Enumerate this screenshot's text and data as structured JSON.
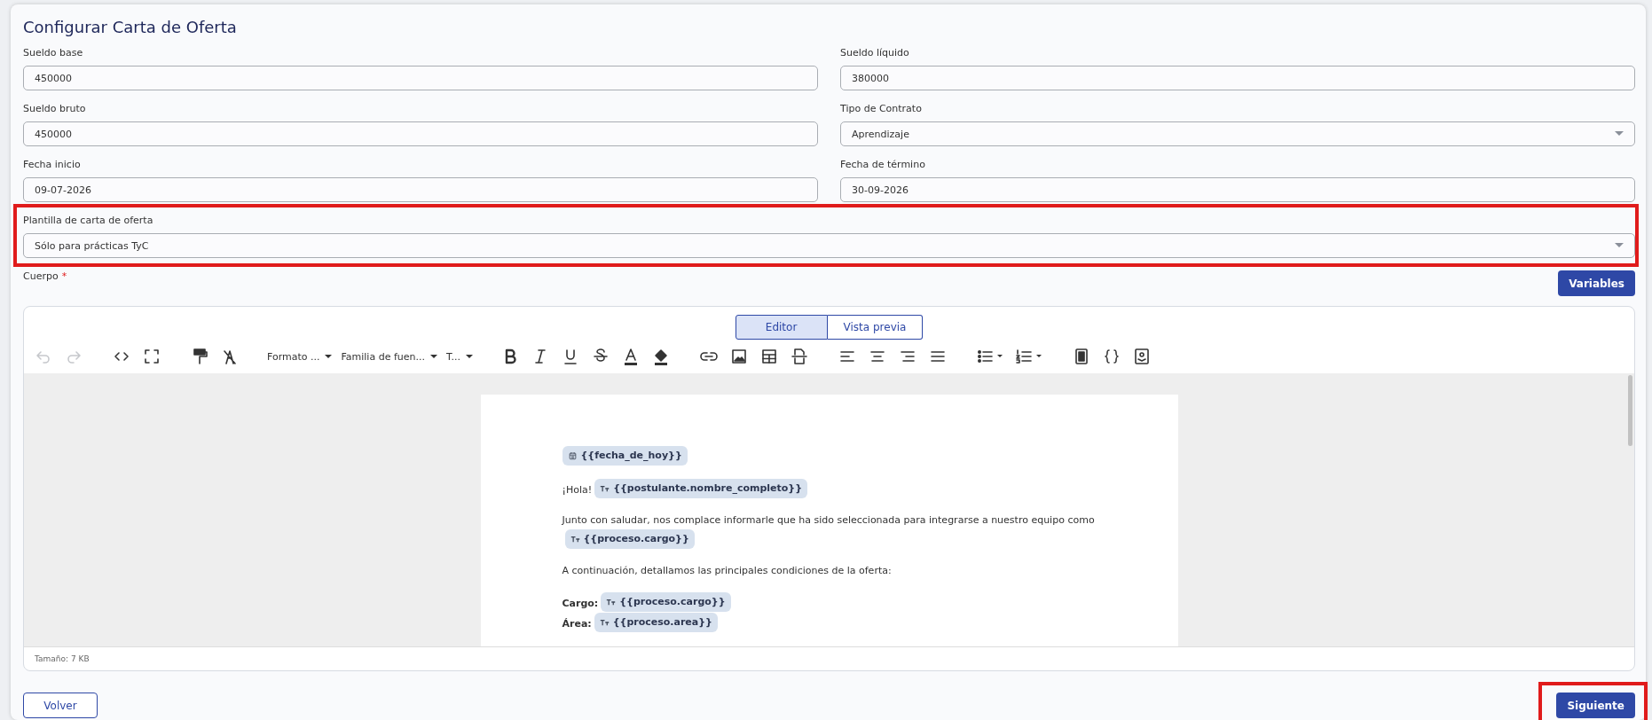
{
  "title": "Configurar Carta de Oferta",
  "fields": [
    {
      "label": "Sueldo base",
      "value": "450000",
      "kind": "text"
    },
    {
      "label": "Sueldo líquido",
      "value": "380000",
      "kind": "text"
    },
    {
      "label": "Sueldo bruto",
      "value": "450000",
      "kind": "text"
    },
    {
      "label": "Tipo de Contrato",
      "value": "Aprendizaje",
      "kind": "select"
    },
    {
      "label": "Fecha inicio",
      "value": "09-07-2026",
      "kind": "text"
    },
    {
      "label": "Fecha de término",
      "value": "30-09-2026",
      "kind": "text"
    }
  ],
  "template_field": {
    "label": "Plantilla de carta de oferta",
    "value": "Sólo para prácticas TyC",
    "highlighted": true
  },
  "body": {
    "label": "Cuerpo",
    "required_mark": "*",
    "variables_button": "Variables"
  },
  "editor": {
    "tabs": [
      {
        "label": "Editor",
        "selected": true
      },
      {
        "label": "Vista previa",
        "selected": false
      }
    ],
    "history": [
      {
        "disabled": true
      },
      {
        "disabled": true
      }
    ],
    "dropdowns": [
      "Formato ...",
      "Familia de fuen...",
      "T..."
    ],
    "document": [
      {
        "kind": "chip",
        "chip": "{{fecha_de_hoy}}"
      },
      {
        "kind": "text_chip",
        "text": "¡Hola!",
        "chip": "{{postulante.nombre_completo}}"
      },
      {
        "kind": "text_chip_below",
        "text": "Junto con saludar, nos complace informarle que ha sido seleccionada para integrarse a nuestro equipo como",
        "chip": "{{proceso.cargo}}"
      },
      {
        "kind": "text",
        "text": "A continuación, detallamos las principales condiciones de la oferta:"
      },
      {
        "kind": "bold_chip",
        "text": "Cargo:",
        "chip": "{{proceso.cargo}}"
      },
      {
        "kind": "bold_chip",
        "text": "Área:",
        "chip": "{{proceso.area}}"
      }
    ],
    "size_label": "Tamaño: 7 KB"
  },
  "buttons": [
    {
      "label": "Volver",
      "kind": "secondary",
      "highlighted": false
    },
    {
      "label": "Siguiente",
      "kind": "primary",
      "highlighted": true
    }
  ]
}
